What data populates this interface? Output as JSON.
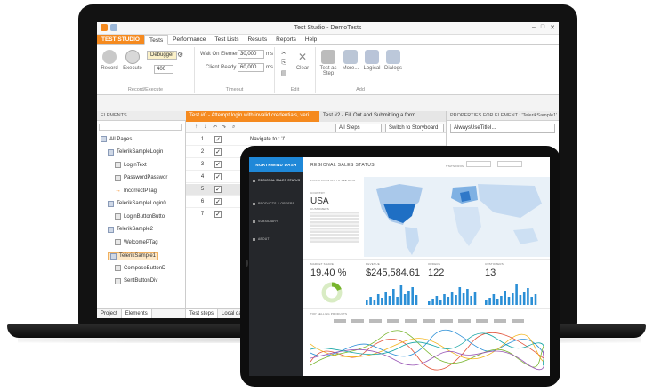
{
  "app": {
    "window_title": "Test Studio - DemoTests",
    "ribbon_tabs": [
      "TEST STUDIO",
      "Tests",
      "Performance",
      "Test Lists",
      "Results",
      "Reports",
      "Help"
    ],
    "ribbon": {
      "record": "Record",
      "execute": "Execute",
      "debugger": "Debugger",
      "speed_value": "400",
      "wait_on_elements_label": "Wait On Elements",
      "wait_on_elements_value": "30,000",
      "client_ready_label": "Client Ready",
      "client_ready_value": "60,000",
      "ms": "ms",
      "clear": "Clear",
      "test_as_step": "Test as Step",
      "more": "More...",
      "logical": "Logical",
      "dialogs": "Dialogs",
      "group_record_execute": "Record/Execute",
      "group_timeout": "Timeout",
      "group_edit": "Edit",
      "group_add": "Add"
    },
    "elements_panel": {
      "header": "ELEMENTS",
      "tree": [
        {
          "label": "All Pages",
          "indent": 0,
          "kind": "folder"
        },
        {
          "label": "TelerikSampleLogin",
          "indent": 1,
          "kind": "page"
        },
        {
          "label": "LoginText",
          "indent": 2,
          "kind": "el"
        },
        {
          "label": "PasswordPasswor",
          "indent": 2,
          "kind": "el"
        },
        {
          "label": "IncorrectPTag",
          "indent": 2,
          "kind": "arrow"
        },
        {
          "label": "TelerikSampleLogin0",
          "indent": 1,
          "kind": "page"
        },
        {
          "label": "LoginButtonButto",
          "indent": 2,
          "kind": "el"
        },
        {
          "label": "TelerikSample2",
          "indent": 1,
          "kind": "page"
        },
        {
          "label": "WelcomePTag",
          "indent": 2,
          "kind": "el"
        },
        {
          "label": "TelerikSample1",
          "indent": 1,
          "kind": "page",
          "selected": true
        },
        {
          "label": "ComposeButtonD",
          "indent": 2,
          "kind": "el"
        },
        {
          "label": "SentButtonDiv",
          "indent": 2,
          "kind": "el"
        }
      ],
      "tabs": [
        "Project",
        "Elements"
      ]
    },
    "steps_panel": {
      "doc_tabs": [
        "Test #0 - Attempt login with invalid credentials, veri...",
        "Test #2 - Fill Out and Submitting a form"
      ],
      "all_steps": "All Steps",
      "switch_storyboard": "Switch to Storyboard",
      "first_step": "Navigate to : '/'",
      "rows": [
        "1",
        "2",
        "3",
        "4",
        "5",
        "6",
        "7"
      ],
      "bottom_tabs": [
        "Test steps",
        "Local data"
      ]
    },
    "props_panel": {
      "header": "PROPERTIES FOR ELEMENT : 'TelerikSample1'",
      "input": "AlwaysUseTitleI..."
    }
  },
  "dashboard": {
    "brand": "NORTHWIND DASH",
    "nav": [
      "REGIONAL SALES STATUS",
      "PRODUCTS & ORDERS",
      "SUBSIDIARY",
      "ABOUT"
    ],
    "title": "REGIONAL SALES STATUS",
    "stats_from": "STATS FROM",
    "pick_hint": "PICK A COUNTRY TO SEE DATA",
    "country_label": "COUNTRY",
    "country": "USA",
    "customers_label": "CUSTOMERS",
    "metrics": [
      {
        "label": "MARKET SHARE",
        "value": "19.40 %"
      },
      {
        "label": "REVENUE",
        "value": "$245,584.61"
      },
      {
        "label": "ORDERS",
        "value": "122"
      },
      {
        "label": "CUSTOMERS",
        "value": "13"
      }
    ],
    "market_share_fraction": 0.194,
    "top_products_label": "TOP SELLING PRODUCTS",
    "colors": {
      "brand": "#1f88d8",
      "sidebar": "#25272b",
      "chart_green": "#78b52d",
      "map_highlight": "#1f6fc4"
    }
  }
}
